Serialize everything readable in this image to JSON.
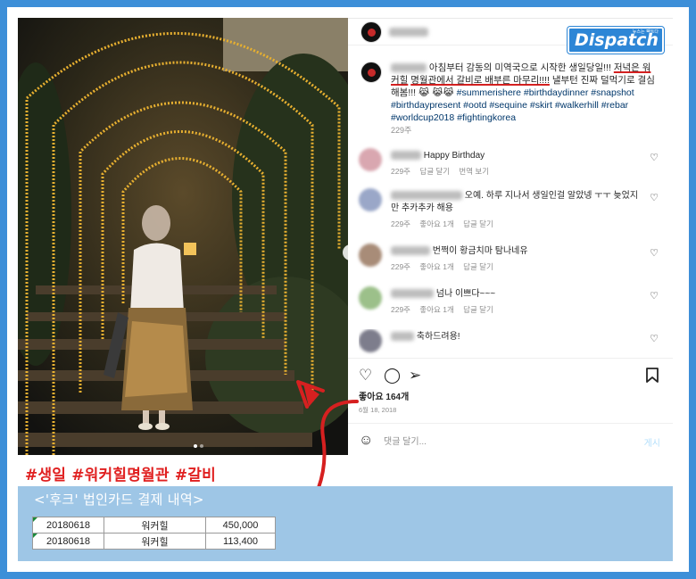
{
  "post": {
    "caption_text": "아침부터 감동의 미역국으로 시작한 생일당일!!! ",
    "caption_hl1": "저녁은 워커힐",
    "caption_hl2": "명월관에서 갈비로 배부른 마무리!!!!",
    "caption_rest": " 낼부턴 진짜 덜먹기로 결심해봄!!! 😹",
    "caption_emoji": "😹😹",
    "hashtags": "#summerishere #birthdaydinner #snapshot #birthdaypresent #ootd #sequine #skirt #walkerhill #rebar #worldcup2018 #fightingkorea",
    "caption_time": "229주",
    "likes": "좋아요 164개",
    "date": "6월 18, 2018",
    "comment_placeholder": "댓글 달기...",
    "post_button": "게시"
  },
  "logo": {
    "text": "Dispatch",
    "tag": "뉴스는 팩트다"
  },
  "comments": [
    {
      "text": "Happy Birthday",
      "time": "229주",
      "reply": "답글 달기",
      "translate": "번역 보기",
      "avatar_color": "#d9a7b0"
    },
    {
      "text": "오예. 하루 지나서 생일인걸 알았넹 ㅜㅜ 늦었지만 추카추카 해용",
      "time": "229주",
      "likes": "좋아요 1개",
      "reply": "답글 달기",
      "avatar_color": "#9aa7c8"
    },
    {
      "text": "번쩍이 황금치마 탐나네유",
      "time": "229주",
      "likes": "좋아요 1개",
      "reply": "답글 달기",
      "avatar_color": "#a88c78"
    },
    {
      "text": "넘나 이쁘다~~~",
      "time": "229주",
      "likes": "좋아요 1개",
      "reply": "답글 달기",
      "avatar_color": "#9cc08a"
    },
    {
      "text": "축하드려용!",
      "avatar_color": "#7d7d8c"
    }
  ],
  "overlay": {
    "hashtags": "#생일 #워커힐명월관 #갈비",
    "card_title": "<'후크' 법인카드 결제 내역>",
    "rows": [
      {
        "date": "20180618",
        "place": "워커힐",
        "amount": "450,000"
      },
      {
        "date": "20180618",
        "place": "워커힐",
        "amount": "113,400"
      }
    ]
  },
  "colors": {
    "accent_red": "#e02020",
    "background_blue": "#3d8fd8",
    "card_blue": "#9ec6e6",
    "link_blue": "#00376b"
  }
}
